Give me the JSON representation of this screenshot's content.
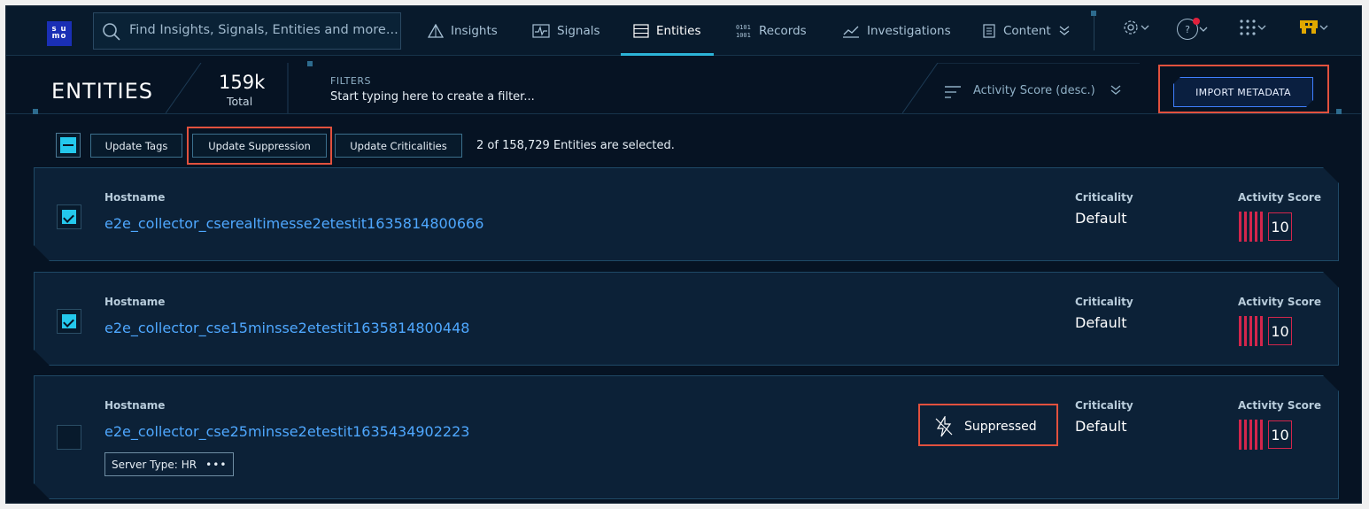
{
  "nav": {
    "logo_line1": "s u",
    "logo_line2": "mo",
    "search_placeholder": "Find Insights, Signals, Entities and more...",
    "items": [
      {
        "label": "Insights",
        "icon": "insights-icon"
      },
      {
        "label": "Signals",
        "icon": "signals-icon"
      },
      {
        "label": "Entities",
        "icon": "entities-icon",
        "active": true
      },
      {
        "label": "Records",
        "icon": "records-icon"
      },
      {
        "label": "Investigations",
        "icon": "investigations-icon"
      },
      {
        "label": "Content",
        "icon": "content-icon"
      }
    ],
    "help_label": "?"
  },
  "header": {
    "title": "ENTITIES",
    "total_value": "159k",
    "total_label": "Total",
    "filters_label": "FILTERS",
    "filters_hint": "Start typing here to create a filter...",
    "sort_label": "Activity Score (desc.)",
    "import_label": "IMPORT METADATA"
  },
  "bulk": {
    "update_tags": "Update Tags",
    "update_suppression": "Update Suppression",
    "update_criticalities": "Update Criticalities",
    "selection_info": "2 of 158,729 Entities are selected."
  },
  "entities": [
    {
      "hostname_label": "Hostname",
      "hostname": "e2e_collector_cserealtimesse2etestit1635814800666",
      "criticality_label": "Criticality",
      "criticality": "Default",
      "score_label": "Activity Score",
      "score": "10",
      "selected": true
    },
    {
      "hostname_label": "Hostname",
      "hostname": "e2e_collector_cse15minsse2etestit1635814800448",
      "criticality_label": "Criticality",
      "criticality": "Default",
      "score_label": "Activity Score",
      "score": "10",
      "selected": true
    },
    {
      "hostname_label": "Hostname",
      "hostname": "e2e_collector_cse25minsse2etestit1635434902223",
      "criticality_label": "Criticality",
      "criticality": "Default",
      "score_label": "Activity Score",
      "score": "10",
      "selected": false,
      "suppressed_label": "Suppressed",
      "tag_key": "Server Type:",
      "tag_value": "HR",
      "tag_more": "•••"
    }
  ],
  "colors": {
    "background": "#061323",
    "accent": "#24c8ec",
    "link": "#4fa8ff",
    "score": "#d3264c",
    "highlight": "#e2513e"
  }
}
